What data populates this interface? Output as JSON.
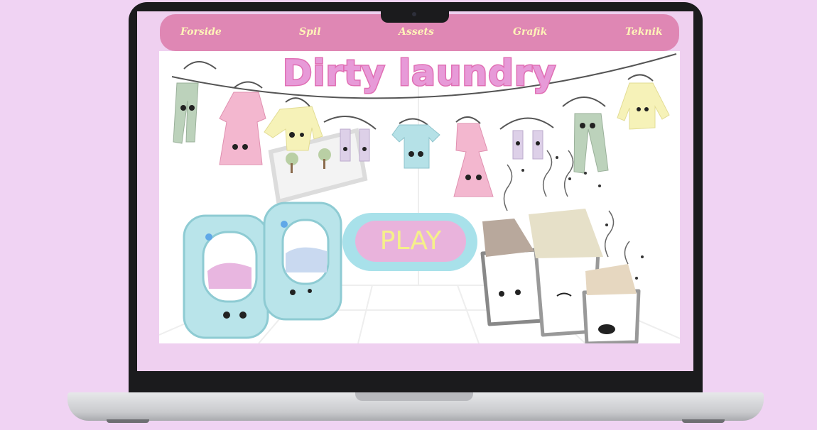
{
  "nav": {
    "items": [
      "Forside",
      "Spil",
      "Assets",
      "Grafik",
      "Teknik"
    ]
  },
  "game": {
    "title": "Dirty laundry",
    "play_label": "PLAY"
  },
  "colors": {
    "page_background": "#f0d3f3",
    "nav_background": "#df87b4",
    "nav_text": "#fff4b8",
    "title": "#e79ad8",
    "play_outer": "#a8e1ea",
    "play_inner": "#e9b3dc",
    "play_text": "#f5f08a"
  },
  "icons": [
    "webcam-icon",
    "clothesline-icon",
    "washing-machine-icon",
    "laundry-basket-icon",
    "shirt-icon",
    "pants-icon",
    "dress-icon",
    "socks-icon",
    "sweater-icon",
    "fly-icon"
  ]
}
